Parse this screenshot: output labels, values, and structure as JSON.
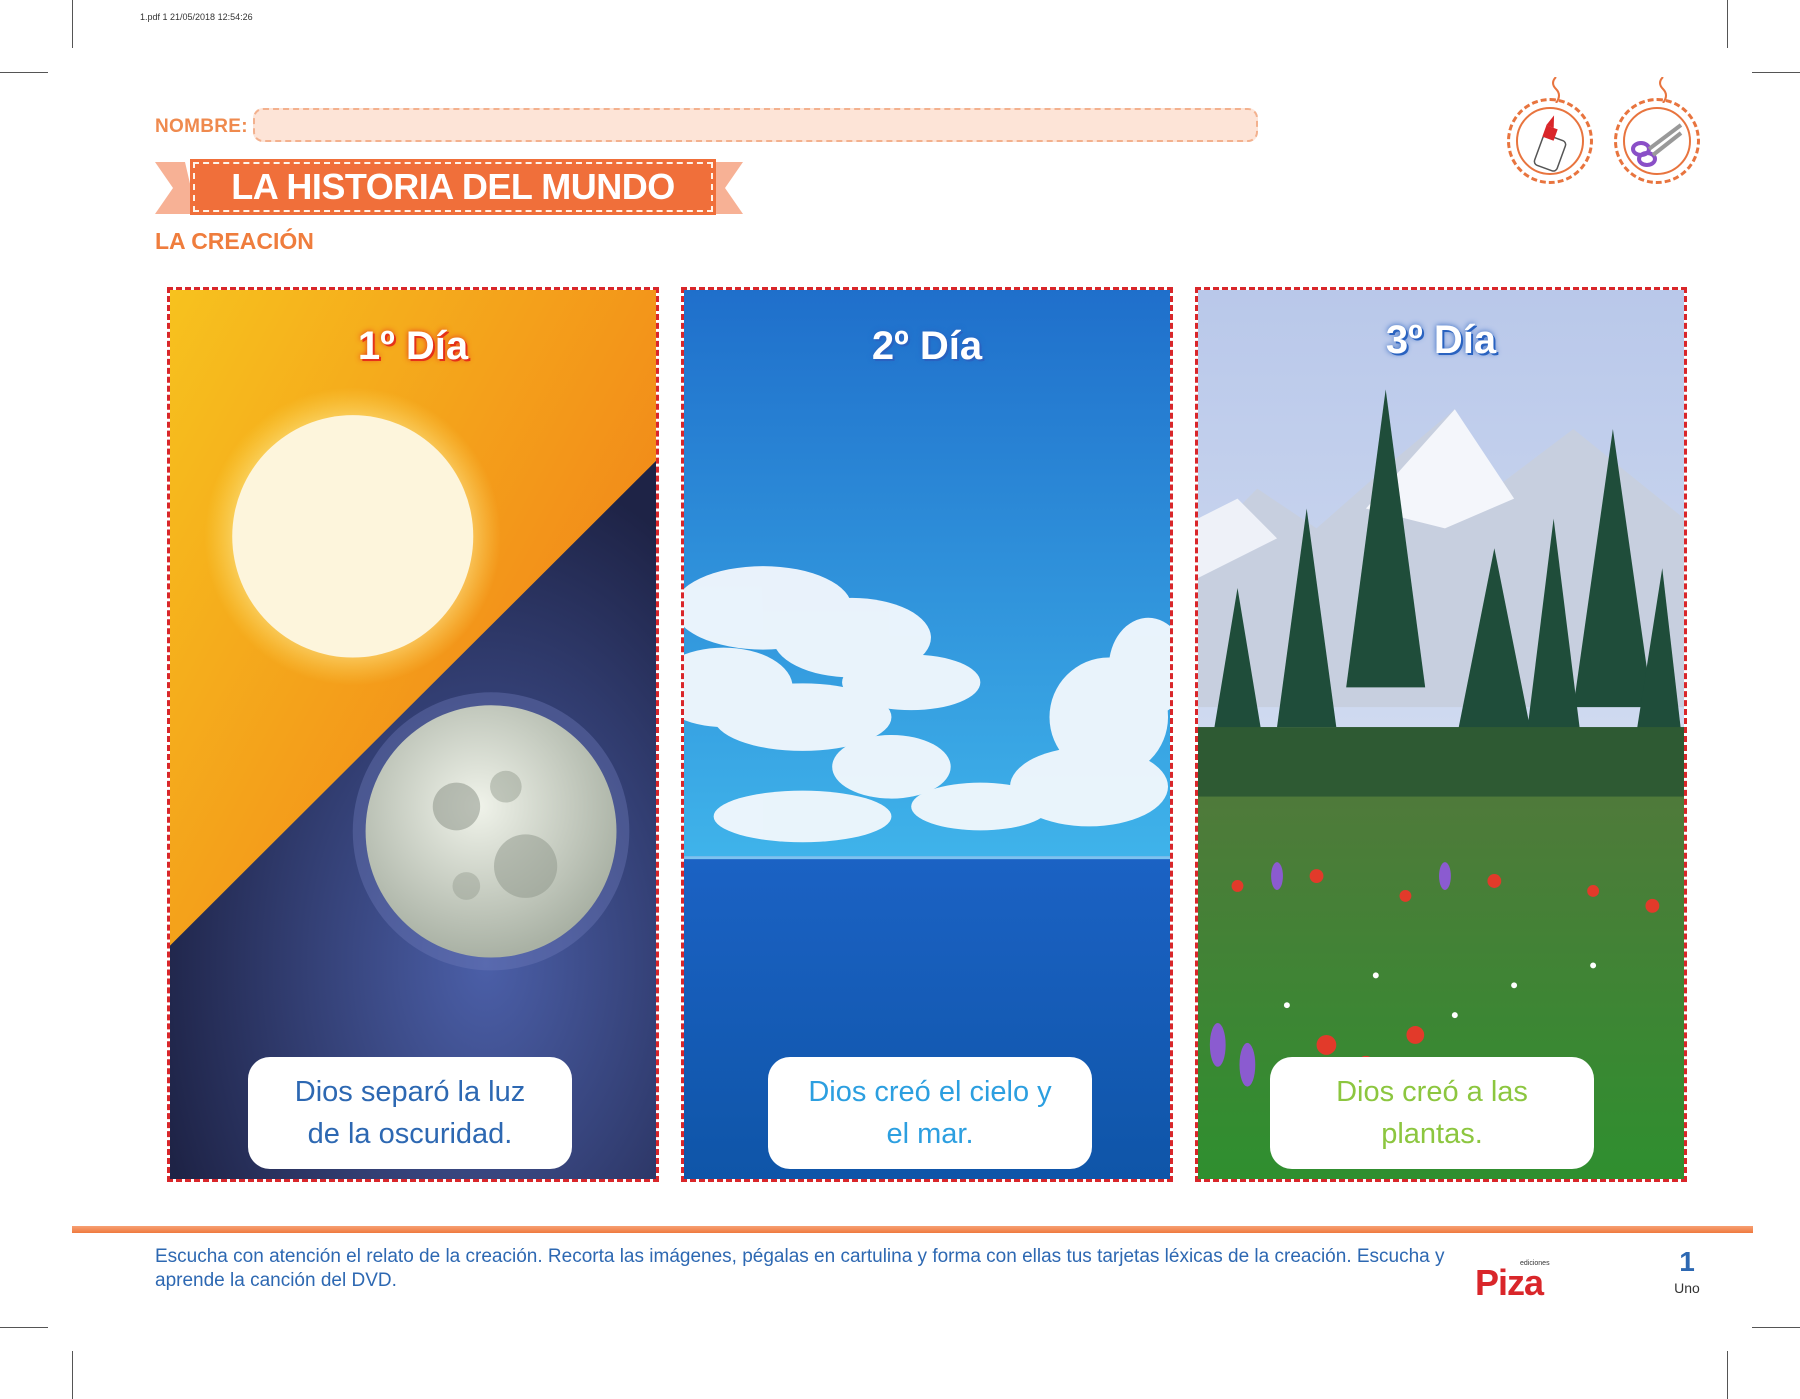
{
  "file_header": "1.pdf   1   21/05/2018   12:54:26",
  "name_field": {
    "label": "NOMBRE:",
    "value": ""
  },
  "title": "LA HISTORIA DEL MUNDO",
  "subtitle": "LA CREACIÓN",
  "tools": [
    "glue-bottle",
    "scissors"
  ],
  "cards": [
    {
      "day": "1º Día",
      "caption_line1": "Dios separó la luz",
      "caption_line2": "de la oscuridad.",
      "caption_color": "#2d68b2"
    },
    {
      "day": "2º Día",
      "caption_line1": "Dios creó el cielo y",
      "caption_line2": "el mar.",
      "caption_color": "#2c9fe0"
    },
    {
      "day": "3º Día",
      "caption_line1": "Dios creó a las",
      "caption_line2": "plantas.",
      "caption_color": "#8cc63f"
    }
  ],
  "instructions": "Escucha con atención el relato de la creación. Recorta las imágenes, pégalas en cartulina y forma con ellas tus tarjetas léxicas de la creación. Escucha y aprende la canción del DVD.",
  "logo": {
    "small": "ediciones",
    "word": "Piza"
  },
  "page": {
    "number": "1",
    "word": "Uno"
  }
}
